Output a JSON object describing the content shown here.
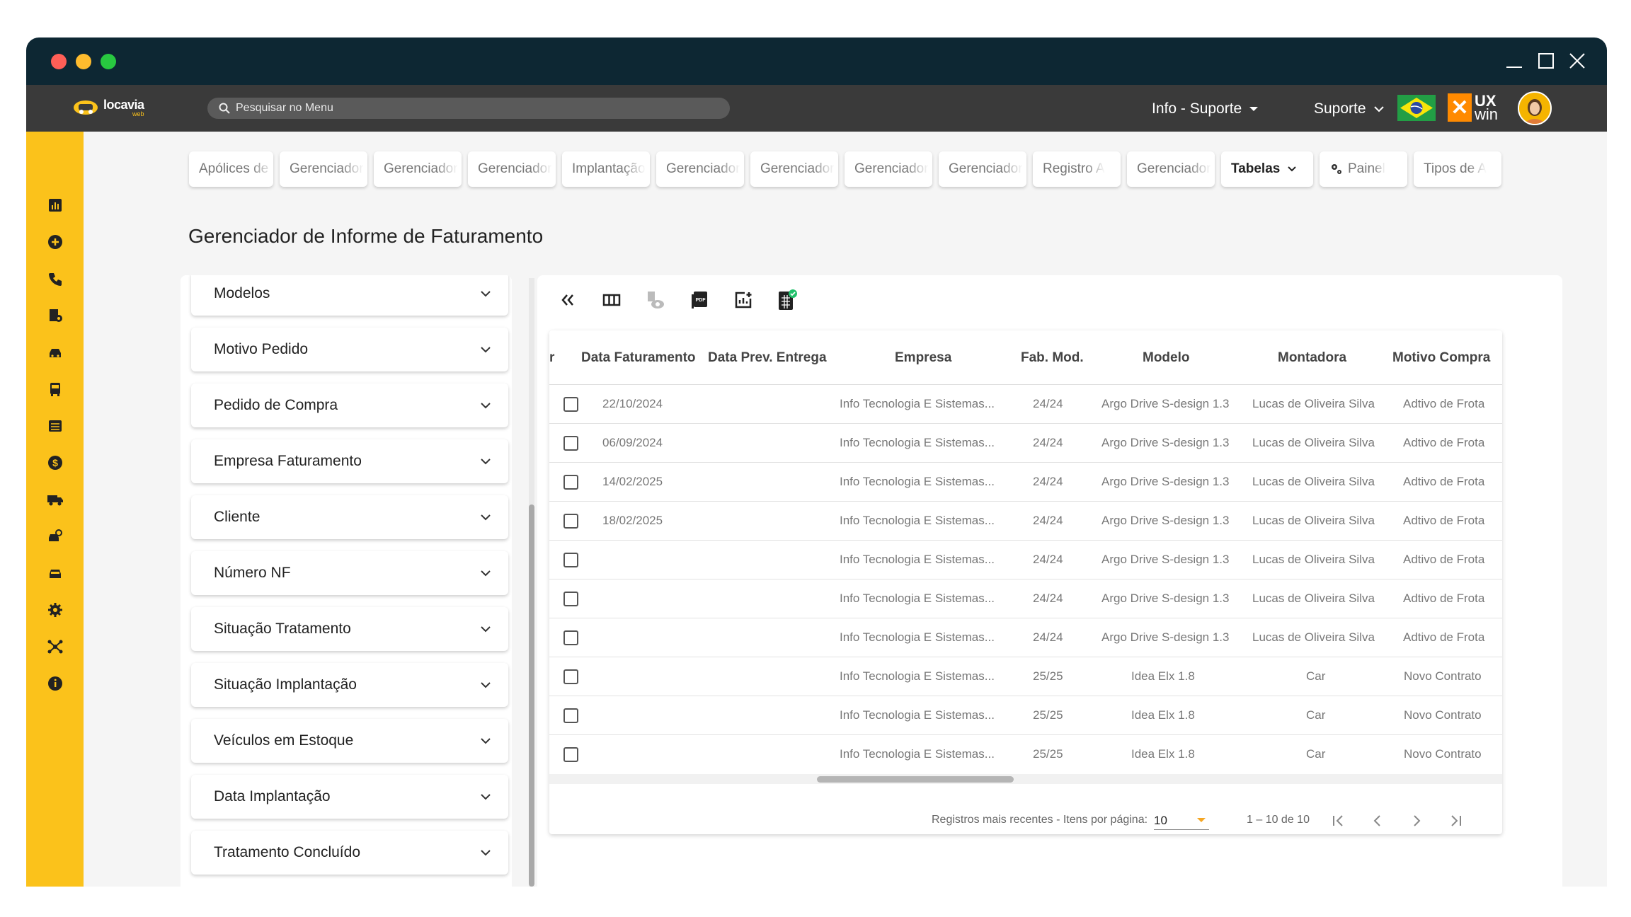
{
  "header": {
    "logo_text": "locavia",
    "logo_sub": "web",
    "search_placeholder": "Pesquisar no Menu",
    "company_dropdown": "Info - Suporte",
    "support_dropdown": "Suporte",
    "brand_ux": "UX",
    "brand_win": "win"
  },
  "tabs": [
    {
      "label": "Apólices de Seguro"
    },
    {
      "label": "Gerenciador"
    },
    {
      "label": "Gerenciador"
    },
    {
      "label": "Gerenciador"
    },
    {
      "label": "Implantação"
    },
    {
      "label": "Gerenciador"
    },
    {
      "label": "Gerenciador"
    },
    {
      "label": "Gerenciador"
    },
    {
      "label": "Gerenciador"
    },
    {
      "label": "Registro A"
    },
    {
      "label": "Gerenciador"
    },
    {
      "label": "Tabelas"
    },
    {
      "label": "Painel"
    },
    {
      "label": "Tipos de A"
    }
  ],
  "page_title": "Gerenciador de Informe de Faturamento",
  "filters": [
    "Modelos",
    "Motivo Pedido",
    "Pedido de Compra",
    "Empresa Faturamento",
    "Cliente",
    "Número NF",
    "Situação Tratamento",
    "Situação Implantação",
    "Veículos em Estoque",
    "Data Implantação",
    "Tratamento Concluído"
  ],
  "table": {
    "columns": {
      "partial": "r",
      "data_faturamento": "Data Faturamento",
      "data_prev_entrega": "Data Prev. Entrega",
      "empresa": "Empresa",
      "fab_mod": "Fab. Mod.",
      "modelo": "Modelo",
      "montadora": "Montadora",
      "motivo_compra": "Motivo Compra"
    },
    "rows": [
      {
        "data_faturamento": "22/10/2024",
        "data_prev_entrega": "",
        "empresa": "Info Tecnologia E Sistemas...",
        "fab_mod": "24/24",
        "modelo": "Argo Drive S-design 1.3",
        "montadora": "Lucas de Oliveira Silva",
        "motivo_compra": "Adtivo de Frota"
      },
      {
        "data_faturamento": "06/09/2024",
        "data_prev_entrega": "",
        "empresa": "Info Tecnologia E Sistemas...",
        "fab_mod": "24/24",
        "modelo": "Argo Drive S-design 1.3",
        "montadora": "Lucas de Oliveira Silva",
        "motivo_compra": "Adtivo de Frota"
      },
      {
        "data_faturamento": "14/02/2025",
        "data_prev_entrega": "",
        "empresa": "Info Tecnologia E Sistemas...",
        "fab_mod": "24/24",
        "modelo": "Argo Drive S-design 1.3",
        "montadora": "Lucas de Oliveira Silva",
        "motivo_compra": "Adtivo de Frota"
      },
      {
        "data_faturamento": "18/02/2025",
        "data_prev_entrega": "",
        "empresa": "Info Tecnologia E Sistemas...",
        "fab_mod": "24/24",
        "modelo": "Argo Drive S-design 1.3",
        "montadora": "Lucas de Oliveira Silva",
        "motivo_compra": "Adtivo de Frota"
      },
      {
        "data_faturamento": "",
        "data_prev_entrega": "",
        "empresa": "Info Tecnologia E Sistemas...",
        "fab_mod": "24/24",
        "modelo": "Argo Drive S-design 1.3",
        "montadora": "Lucas de Oliveira Silva",
        "motivo_compra": "Adtivo de Frota"
      },
      {
        "data_faturamento": "",
        "data_prev_entrega": "",
        "empresa": "Info Tecnologia E Sistemas...",
        "fab_mod": "24/24",
        "modelo": "Argo Drive S-design 1.3",
        "montadora": "Lucas de Oliveira Silva",
        "motivo_compra": "Adtivo de Frota"
      },
      {
        "data_faturamento": "",
        "data_prev_entrega": "",
        "empresa": "Info Tecnologia E Sistemas...",
        "fab_mod": "24/24",
        "modelo": "Argo Drive S-design 1.3",
        "montadora": "Lucas de Oliveira Silva",
        "motivo_compra": "Adtivo de Frota"
      },
      {
        "data_faturamento": "",
        "data_prev_entrega": "",
        "empresa": "Info Tecnologia E Sistemas...",
        "fab_mod": "25/25",
        "modelo": "Idea Elx 1.8",
        "montadora": "Car",
        "motivo_compra": "Novo Contrato"
      },
      {
        "data_faturamento": "",
        "data_prev_entrega": "",
        "empresa": "Info Tecnologia E Sistemas...",
        "fab_mod": "25/25",
        "modelo": "Idea Elx 1.8",
        "montadora": "Car",
        "motivo_compra": "Novo Contrato"
      },
      {
        "data_faturamento": "",
        "data_prev_entrega": "",
        "empresa": "Info Tecnologia E Sistemas...",
        "fab_mod": "25/25",
        "modelo": "Idea Elx 1.8",
        "montadora": "Car",
        "motivo_compra": "Novo Contrato"
      }
    ]
  },
  "pagination": {
    "items_label": "Registros mais recentes - Itens por página:",
    "page_size": "10",
    "range": "1 – 10 de 10"
  },
  "colors": {
    "sidebar": "#fbc21b",
    "titlebar": "#0d2733",
    "appbar": "#3a3a3a"
  }
}
